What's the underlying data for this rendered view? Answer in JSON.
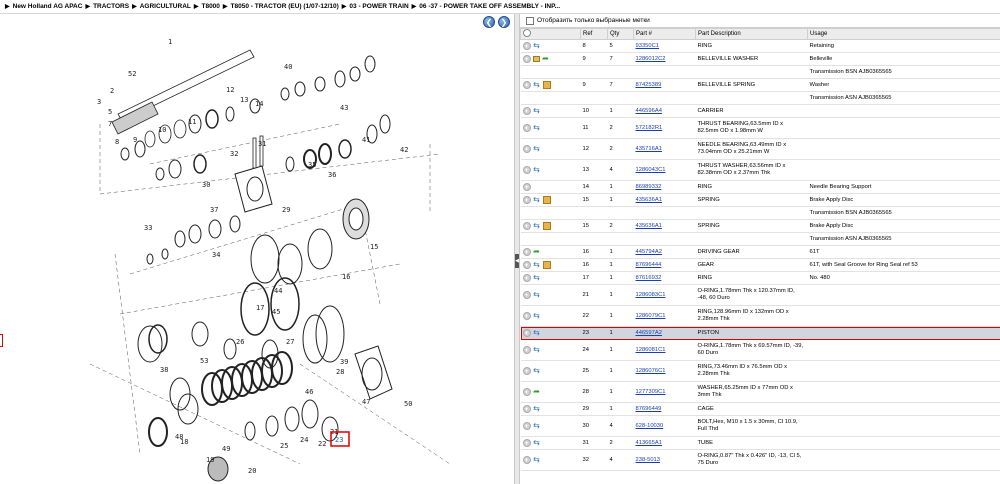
{
  "breadcrumb": {
    "items": [
      "New Holland AG APAC",
      "TRACTORS",
      "AGRICULTURAL",
      "T8000",
      "T8050 - TRACTOR (EU) (1/07-12/10)",
      "03 - POWER TRAIN",
      "06 -37 - POWER TAKE OFF ASSEMBLY - INP..."
    ]
  },
  "nav": {
    "back_symbol": "❮",
    "forward_symbol": "❯"
  },
  "filter": {
    "label": "Отобразить только выбранные метки"
  },
  "table": {
    "headers": [
      "",
      "Ref",
      "Qty",
      "Part #",
      "Part Description",
      "Usage"
    ],
    "rows": [
      {
        "icons": [
          "add",
          "swap"
        ],
        "ref": "8",
        "qty": "5",
        "part": "93350C1",
        "desc": "RING",
        "usage": "Retaining"
      },
      {
        "icons": [
          "add",
          "box2",
          "arrow"
        ],
        "ref": "9",
        "qty": "7",
        "part": "1286012C2",
        "desc": "BELLEVILLE WASHER",
        "usage": "Belleville"
      },
      {
        "sub": true,
        "usage": "Transmission BSN AJB0365565"
      },
      {
        "icons": [
          "add",
          "swap",
          "box"
        ],
        "ref": "9",
        "qty": "7",
        "part": "87425389",
        "desc": "BELLEVILLE SPRING",
        "usage": "Washer"
      },
      {
        "sub": true,
        "usage": "Transmission ASN AJB0365565"
      },
      {
        "icons": [
          "add",
          "swap"
        ],
        "ref": "10",
        "qty": "1",
        "part": "446596A4",
        "desc": "CARRIER",
        "usage": ""
      },
      {
        "icons": [
          "add",
          "swap"
        ],
        "ref": "11",
        "qty": "2",
        "part": "572182R1",
        "desc": "THRUST BEARING,63.5mm ID x 82.5mm OD x 1.98mm W",
        "usage": "",
        "tall": true
      },
      {
        "icons": [
          "add",
          "swap"
        ],
        "ref": "12",
        "qty": "2",
        "part": "435716A1",
        "desc": "NEEDLE BEARING,63.49mm ID x 73.04mm OD x 25.21mm W",
        "usage": "",
        "tall": true
      },
      {
        "icons": [
          "add",
          "swap"
        ],
        "ref": "13",
        "qty": "4",
        "part": "1286043C1",
        "desc": "THRUST WASHER,63.56mm ID x 82.38mm OD x 2.37mm Thk",
        "usage": "",
        "tall": true
      },
      {
        "icons": [
          "add"
        ],
        "ref": "14",
        "qty": "1",
        "part": "86989332",
        "desc": "RING",
        "usage": "Needle Bearing Support"
      },
      {
        "icons": [
          "add",
          "swap",
          "box"
        ],
        "ref": "15",
        "qty": "1",
        "part": "435636A1",
        "desc": "SPRING",
        "usage": "Brake Apply Disc"
      },
      {
        "sub": true,
        "usage": "Transmission BSN AJB0365565"
      },
      {
        "icons": [
          "add",
          "swap",
          "box"
        ],
        "ref": "15",
        "qty": "2",
        "part": "435636A1",
        "desc": "SPRING",
        "usage": "Brake Apply Disc"
      },
      {
        "sub": true,
        "usage": "Transmission ASN AJB0365565"
      },
      {
        "icons": [
          "add",
          "arrow"
        ],
        "ref": "16",
        "qty": "1",
        "part": "445794A2",
        "desc": "DRIVING GEAR",
        "usage": "61T"
      },
      {
        "icons": [
          "add",
          "swap",
          "box"
        ],
        "ref": "16",
        "qty": "1",
        "part": "87696444",
        "desc": "GEAR",
        "usage": "61T, with Seal Groove for Ring Seal ref 53"
      },
      {
        "icons": [
          "add",
          "swap"
        ],
        "ref": "17",
        "qty": "1",
        "part": "87616932",
        "desc": "RING",
        "usage": "No. 480"
      },
      {
        "icons": [
          "add",
          "swap"
        ],
        "ref": "21",
        "qty": "1",
        "part": "1286083C1",
        "desc": "O-RING,1.78mm Thk x 120.37mm ID, -48, 60 Duro",
        "usage": "",
        "tall": true
      },
      {
        "icons": [
          "add",
          "swap"
        ],
        "ref": "22",
        "qty": "1",
        "part": "1286079C1",
        "desc": "RING,128.96mm ID x 132mm OD x 2.28mm Thk",
        "usage": "",
        "tall": true
      },
      {
        "icons": [
          "add",
          "swap"
        ],
        "ref": "23",
        "qty": "1",
        "part": "446597A2",
        "desc": "PISTON",
        "usage": "",
        "selected": true
      },
      {
        "icons": [
          "add",
          "swap"
        ],
        "ref": "24",
        "qty": "1",
        "part": "1286081C1",
        "desc": "O-RING,1.78mm Thk x 69.57mm ID, -39, 60 Duro",
        "usage": "",
        "tall": true
      },
      {
        "icons": [
          "add",
          "swap"
        ],
        "ref": "25",
        "qty": "1",
        "part": "1286076C1",
        "desc": "RING,73.46mm ID x 76.5mm OD x 2.28mm Thk",
        "usage": "",
        "tall": true
      },
      {
        "icons": [
          "add",
          "arrow"
        ],
        "ref": "28",
        "qty": "1",
        "part": "1277309C1",
        "desc": "WASHER,65.25mm ID x 77mm OD x 3mm Thk",
        "usage": "",
        "tall": true
      },
      {
        "icons": [
          "add",
          "swap"
        ],
        "ref": "29",
        "qty": "1",
        "part": "87696449",
        "desc": "CAGE",
        "usage": ""
      },
      {
        "icons": [
          "add",
          "swap"
        ],
        "ref": "30",
        "qty": "4",
        "part": "628-10030",
        "desc": "BOLT,Hex, M10 x 1.5 x 30mm, Cl 10.9, Full Thd",
        "usage": "",
        "tall": true
      },
      {
        "icons": [
          "add",
          "swap"
        ],
        "ref": "31",
        "qty": "2",
        "part": "413665A1",
        "desc": "TUBE",
        "usage": ""
      },
      {
        "icons": [
          "add",
          "swap"
        ],
        "ref": "32",
        "qty": "4",
        "part": "238-5013",
        "desc": "O-RING,0.87\" Thk x 0.426\" ID, -13, Cl 5, 75 Duro",
        "usage": "",
        "tall": true
      }
    ]
  },
  "diagram": {
    "labels": [
      {
        "t": "1"
      },
      {
        "t": "52"
      },
      {
        "t": "2"
      },
      {
        "t": "3"
      },
      {
        "t": "5"
      },
      {
        "t": "7"
      },
      {
        "t": "8"
      },
      {
        "t": "9"
      },
      {
        "t": "10"
      },
      {
        "t": "11"
      },
      {
        "t": "12"
      },
      {
        "t": "13"
      },
      {
        "t": "14"
      },
      {
        "t": "40"
      },
      {
        "t": "41"
      },
      {
        "t": "42"
      },
      {
        "t": "43"
      },
      {
        "t": "32"
      },
      {
        "t": "31"
      },
      {
        "t": "30"
      },
      {
        "t": "29"
      },
      {
        "t": "35"
      },
      {
        "t": "36"
      },
      {
        "t": "37"
      },
      {
        "t": "34"
      },
      {
        "t": "38"
      },
      {
        "t": "33"
      },
      {
        "t": "44"
      },
      {
        "t": "45"
      },
      {
        "t": "17"
      },
      {
        "t": "53"
      },
      {
        "t": "16"
      },
      {
        "t": "15"
      },
      {
        "t": "39"
      },
      {
        "t": "46"
      },
      {
        "t": "26"
      },
      {
        "t": "27"
      },
      {
        "t": "28"
      },
      {
        "t": "47"
      },
      {
        "t": "50"
      },
      {
        "t": "49"
      },
      {
        "t": "48"
      },
      {
        "t": "19"
      },
      {
        "t": "18"
      },
      {
        "t": "20"
      },
      {
        "t": "25"
      },
      {
        "t": "24"
      },
      {
        "t": "22"
      },
      {
        "t": "21"
      }
    ],
    "highlight_label": "23"
  }
}
